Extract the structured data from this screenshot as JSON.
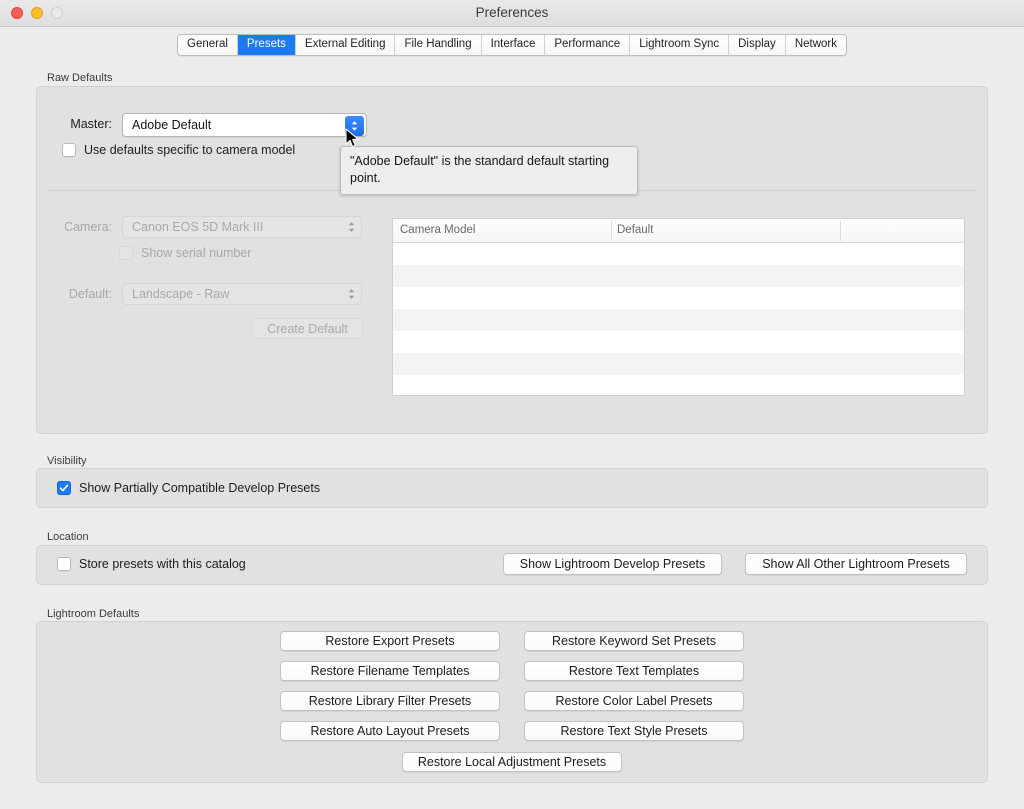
{
  "window": {
    "title": "Preferences",
    "traffic_lights": [
      "close-button",
      "minimize-button",
      "zoom-button"
    ]
  },
  "tabs": [
    {
      "label": "General",
      "active": false
    },
    {
      "label": "Presets",
      "active": true
    },
    {
      "label": "External Editing",
      "active": false
    },
    {
      "label": "File Handling",
      "active": false
    },
    {
      "label": "Interface",
      "active": false
    },
    {
      "label": "Performance",
      "active": false
    },
    {
      "label": "Lightroom Sync",
      "active": false
    },
    {
      "label": "Display",
      "active": false
    },
    {
      "label": "Network",
      "active": false
    }
  ],
  "raw_defaults": {
    "group_label": "Raw Defaults",
    "master_label": "Master:",
    "master_value": "Adobe Default",
    "use_camera_defaults_label": "Use defaults specific to camera model",
    "use_camera_defaults_checked": false,
    "camera_label": "Camera:",
    "camera_value": "Canon EOS 5D Mark III",
    "show_serial_label": "Show serial number",
    "show_serial_checked": false,
    "default_label": "Default:",
    "default_value": "Landscape - Raw",
    "create_default_button": "Create Default",
    "table": {
      "columns": [
        "Camera Model",
        "Default"
      ],
      "rows": [
        [],
        [],
        [],
        [],
        [],
        [],
        []
      ]
    }
  },
  "tooltip": {
    "text": "\"Adobe Default\" is the standard default starting point."
  },
  "visibility": {
    "group_label": "Visibility",
    "checkbox_label": "Show Partially Compatible Develop Presets",
    "checked": true
  },
  "location": {
    "group_label": "Location",
    "checkbox_label": "Store presets with this catalog",
    "checked": false,
    "buttons": [
      "Show Lightroom Develop Presets",
      "Show All Other Lightroom Presets"
    ]
  },
  "lightroom_defaults": {
    "group_label": "Lightroom Defaults",
    "left_buttons": [
      "Restore Export Presets",
      "Restore Filename Templates",
      "Restore Library Filter Presets",
      "Restore Auto Layout Presets"
    ],
    "right_buttons": [
      "Restore Keyword Set Presets",
      "Restore Text Templates",
      "Restore Color Label Presets",
      "Restore Text Style Presets"
    ],
    "bottom_button": "Restore Local Adjustment Presets"
  },
  "colors": {
    "accent": "#1a7bf4",
    "window_bg": "#ececec",
    "group_bg": "#e1e1e1",
    "tooltip_bg": "#ededed"
  }
}
